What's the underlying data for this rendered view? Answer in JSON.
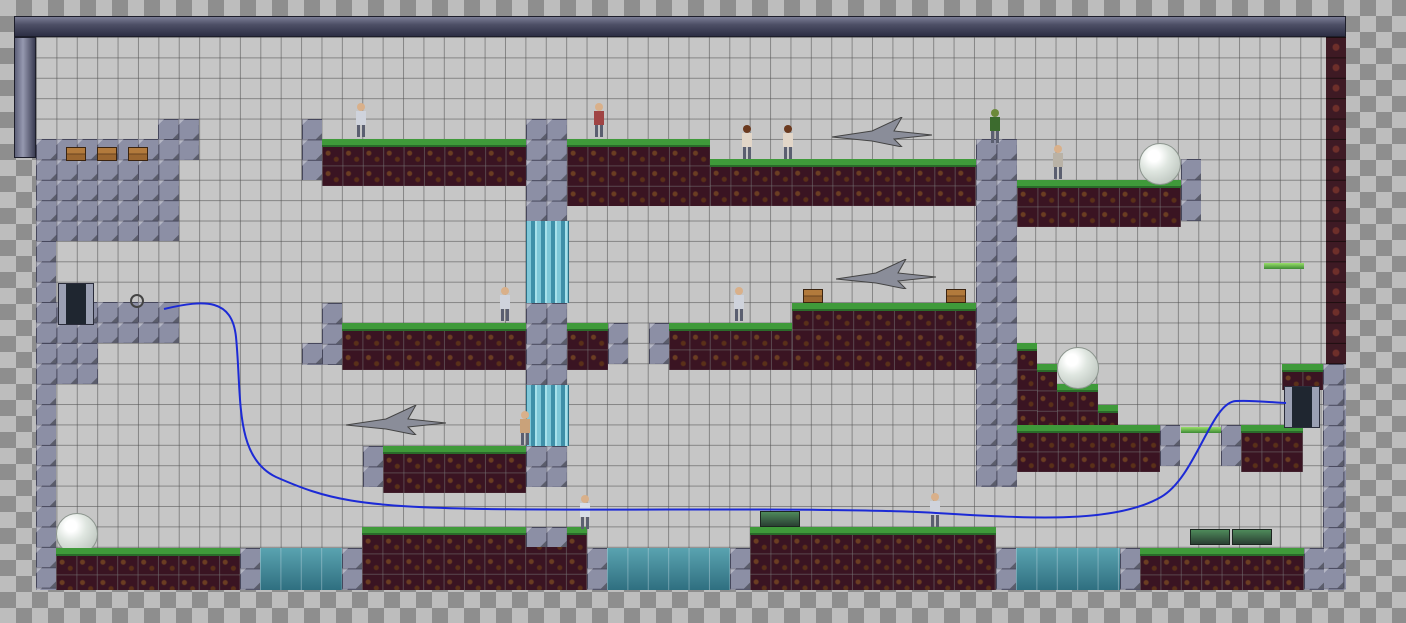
{
  "scene": {
    "kind": "tile level editor view",
    "colors": {
      "grid": "#c6c6c6",
      "stone": "#8c8fa5",
      "dirt": "#3a1422",
      "grass": "#3f9a3a",
      "water": "#4f93a0",
      "path_line": "#1c2ad6",
      "frame": "#4d4f66"
    },
    "icons": [
      "chest-icon",
      "jet-fighter-icon",
      "soldier-icon",
      "bubble-icon",
      "door-icon",
      "turret-icon",
      "crosshair-icon"
    ]
  }
}
